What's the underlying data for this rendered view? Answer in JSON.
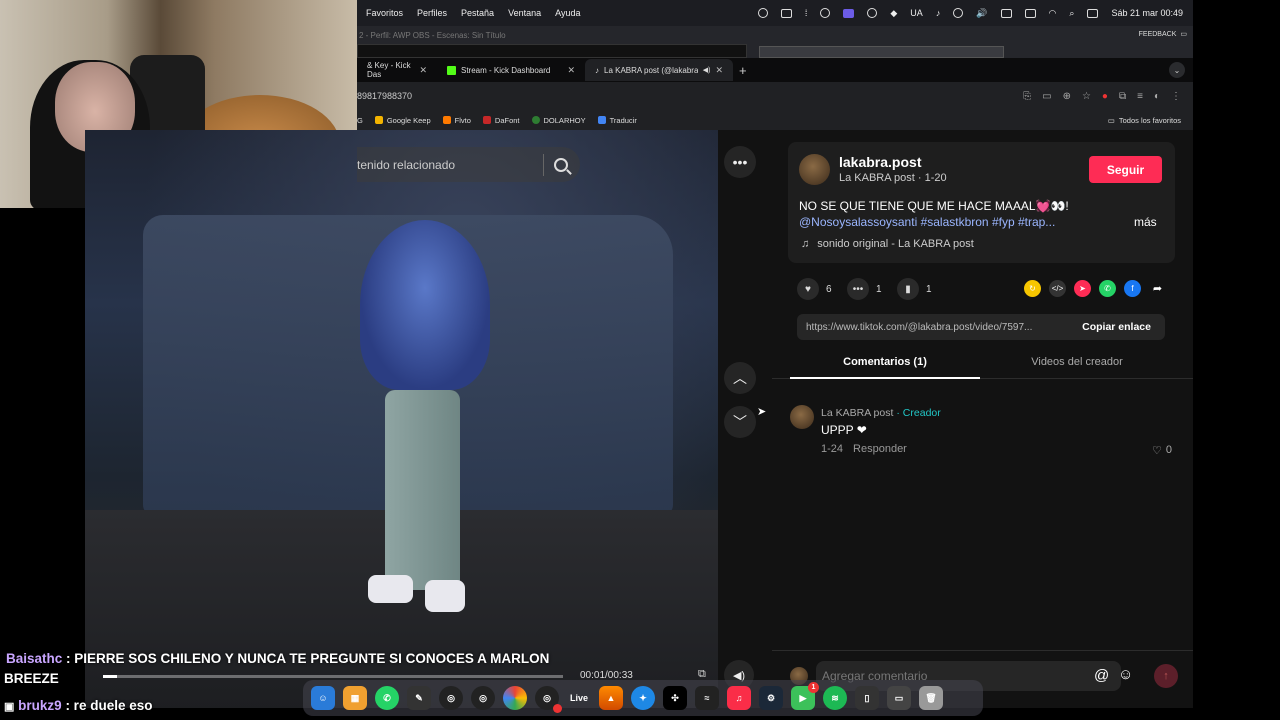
{
  "menubar": {
    "menus": [
      "Favoritos",
      "Perfiles",
      "Pestaña",
      "Ventana",
      "Ayuda"
    ],
    "input_source": "UA",
    "datetime": "Sáb 21 mar  00:49"
  },
  "obs": {
    "title": "2 - Perfil: AWP OBS - Escenas: Sin Título",
    "feedback_label": "FEEDBACK"
  },
  "browser": {
    "tabs": [
      {
        "label": "& Key - Kick Das",
        "active": false
      },
      {
        "label": "Stream - Kick Dashboard",
        "active": false
      },
      {
        "label": "La KABRA post (@lakabra",
        "active": true
      }
    ],
    "url": "89817988370",
    "bookmarks": [
      "Google Keep",
      "Flvto",
      "DaFont",
      "DOLARHOY",
      "Traducir"
    ],
    "all_bookmarks": "Todos los favoritos"
  },
  "video": {
    "search_placeholder": "tenido relacionado",
    "time": "00:01/00:33",
    "progress_fraction": 0.03
  },
  "post": {
    "username": "lakabra.post",
    "display_name": "La KABRA post · 1-20",
    "follow_label": "Seguir",
    "caption": "NO SE QUE TIENE QUE ME HACE MAAAL💓👀!",
    "hashtags": "@Nosoysalassoysanti #salastkbron #fyp #trap...",
    "more_label": "más",
    "sound": "sonido original - La KABRA post",
    "likes": "6",
    "comments": "1",
    "saves": "1",
    "link": "https://www.tiktok.com/@lakabra.post/video/7597...",
    "copy_link_label": "Copiar enlace",
    "tab_comments": "Comentarios (1)",
    "tab_creator_videos": "Videos del creador",
    "add_comment_placeholder": "Agregar comentario"
  },
  "comment": {
    "author": "La KABRA post",
    "creator_tag": "· Creador",
    "text": "UPPP ❤",
    "date": "1-24",
    "reply_label": "Responder",
    "likes": "0"
  },
  "chat": [
    {
      "user": "Baisathc",
      "text": " : PIERRE SOS CHILENO Y NUNCA TE PREGUNTE SI CONOCES A MARLON",
      "continuation": "BREEZE",
      "user_color": "#c9a6ff"
    },
    {
      "user": "brukz9",
      "text": " : re duele eso",
      "user_color": "#c9a6ff"
    }
  ],
  "dock": {
    "live_label": "Live",
    "notification_badge": "1"
  },
  "colors": {
    "follow_button": "#fe2c55",
    "creator_tag": "#22c7c7",
    "kick_green": "#53fc18"
  }
}
